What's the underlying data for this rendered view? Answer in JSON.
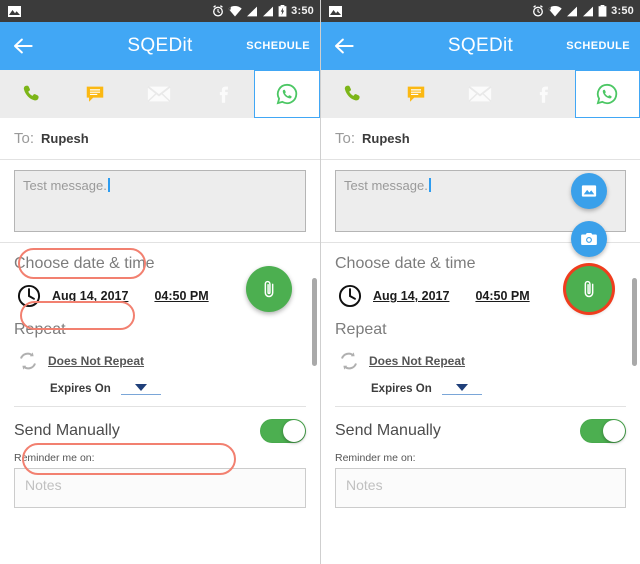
{
  "status_bar": {
    "time": "3:50",
    "icons_left": [
      "image-notification-icon"
    ],
    "icons_right": [
      "alarm-icon",
      "wifi-icon",
      "signal-icon",
      "signal-icon-2",
      "battery-icon"
    ]
  },
  "app_bar": {
    "back_label": "back-arrow",
    "title": "SQEDit",
    "action_label": "SCHEDULE"
  },
  "tabs": [
    {
      "name": "phone",
      "icon": "phone-icon",
      "selected": false
    },
    {
      "name": "sms",
      "icon": "chat-bubble-icon",
      "selected": false
    },
    {
      "name": "email",
      "icon": "envelope-icon",
      "selected": false
    },
    {
      "name": "facebook",
      "icon": "facebook-icon",
      "selected": false
    },
    {
      "name": "whatsapp",
      "icon": "whatsapp-icon",
      "selected": true
    }
  ],
  "form": {
    "to_label": "To:",
    "to_value": "Rupesh",
    "message_value": "Test message.",
    "section_datetime_title": "Choose date & time",
    "date_value": "Aug 14, 2017",
    "time_value": "04:50 PM",
    "section_repeat_title": "Repeat",
    "repeat_value": "Does Not Repeat",
    "expires_label": "Expires On",
    "expires_value": "",
    "send_manually_label": "Send Manually",
    "send_manually_on": true,
    "reminder_label": "Reminder me on:",
    "notes_placeholder": "Notes"
  },
  "fab": {
    "attach_icon": "paperclip-icon",
    "gallery_icon": "gallery-icon",
    "camera_icon": "camera-icon"
  },
  "colors": {
    "app_bar": "#41a7f5",
    "status_bar": "#3b3b3b",
    "fab_green": "#4caf50",
    "mini_fab_blue": "#3aa0ea",
    "annotation": "#f28070",
    "annotation_ring": "#ef3d1e",
    "toggle_on": "#4caf50",
    "tab_bar": "#ececec"
  },
  "annotations": {
    "left_panel": [
      "to-field",
      "message-field",
      "datetime-row"
    ],
    "right_panel": [
      "attach-fab"
    ]
  }
}
